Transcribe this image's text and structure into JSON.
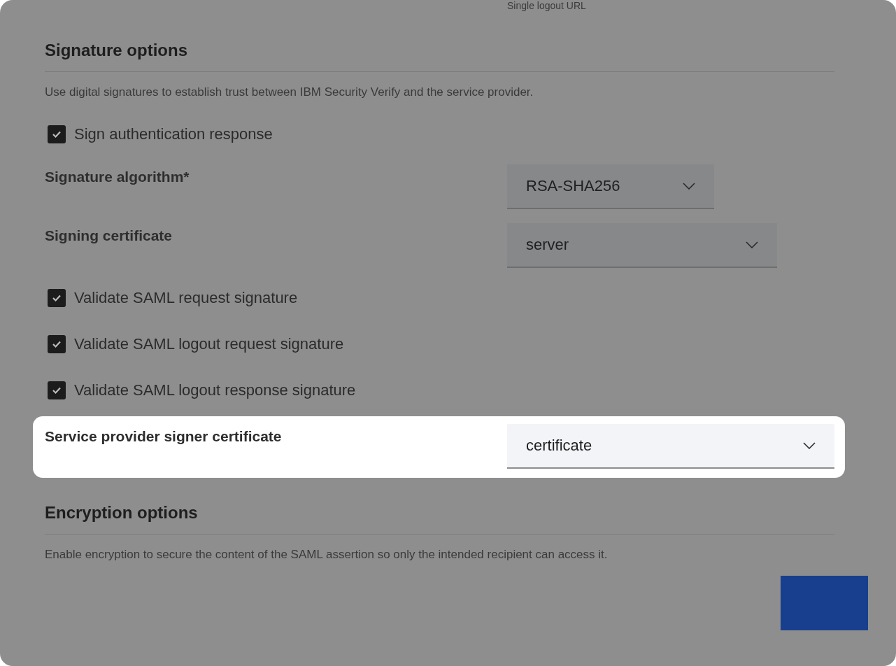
{
  "cut_label": "Single logout URL",
  "signature": {
    "title": "Signature options",
    "description": "Use digital signatures to establish trust between IBM Security Verify and the service provider.",
    "rows": [
      {
        "kind": "checkbox",
        "label": "Sign authentication response",
        "checked": true
      },
      {
        "kind": "select",
        "label": "Signature algorithm*",
        "value": "RSA-SHA256",
        "highlighted": false
      },
      {
        "kind": "select",
        "label": "Signing certificate",
        "value": "server",
        "highlighted": false
      },
      {
        "kind": "checkbox",
        "label": "Validate SAML request signature",
        "checked": true
      },
      {
        "kind": "checkbox",
        "label": "Validate SAML logout request signature",
        "checked": true
      },
      {
        "kind": "checkbox",
        "label": "Validate SAML logout response signature",
        "checked": true
      },
      {
        "kind": "select",
        "label": "Service provider signer certificate",
        "value": "certificate",
        "highlighted": true
      }
    ]
  },
  "encryption": {
    "title": "Encryption options",
    "description": "Enable encryption to secure the content of the SAML assertion so only the intended recipient can access it."
  },
  "action_button": {
    "kind": "blank"
  }
}
